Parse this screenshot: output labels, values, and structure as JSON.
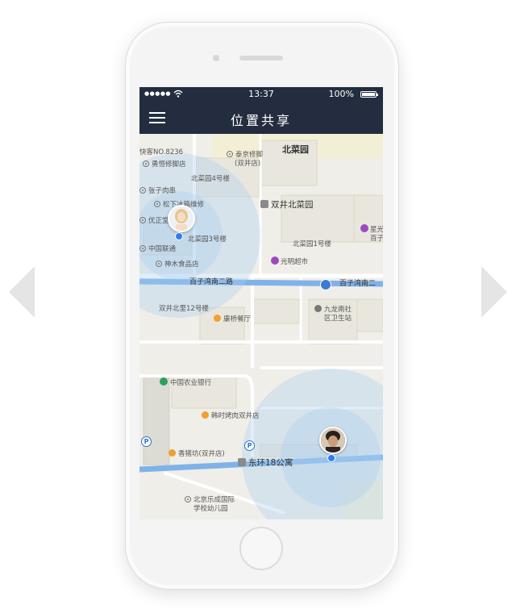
{
  "status": {
    "time": "13:37",
    "battery": "100%",
    "signal": "●●●●●"
  },
  "nav": {
    "title": "位置共享"
  },
  "map": {
    "labels": {
      "express": "快客NO.8236",
      "bike": "勇恒修脚店",
      "taijing": "泰京修脚",
      "taijing2": "(双井店)",
      "beicaiyuan": "北菜园",
      "bcy4": "北菜园4号楼",
      "zhangzi": "张子肉串",
      "songxia": "松下冰箱维修",
      "shuangjing": "双井北菜园",
      "youzheng": "优正堂",
      "bcy3": "北菜园3号楼",
      "unicom": "中国联通",
      "bcy1": "北菜园1号楼",
      "star": "星光",
      "star2": "百子",
      "shenmu": "神木食品店",
      "guangming": "光明超市",
      "road1": "百子湾南二路",
      "road1b": "百子湾南二",
      "bl12": "双井北里12号楼",
      "kangqiao": "康桥餐厅",
      "jiulong": "九龙南社",
      "jiulong2": "区卫生站",
      "abc": "中国农业银行",
      "hanshi": "韩时烤肉双井店",
      "xiangzhu": "香猪坊(双井店)",
      "dh18": "东环18公寓",
      "school": "北京乐成国际",
      "school2": "学校幼儿园"
    },
    "parking": "P",
    "users": [
      {
        "name": "user-female",
        "icon": "avatar-female"
      },
      {
        "name": "user-male",
        "icon": "avatar-male"
      }
    ],
    "colors": {
      "road": "#7fb2e8",
      "accuracy": "#a9cdf2",
      "navbar": "#232d3f",
      "dot": "#2d7cf0"
    }
  }
}
